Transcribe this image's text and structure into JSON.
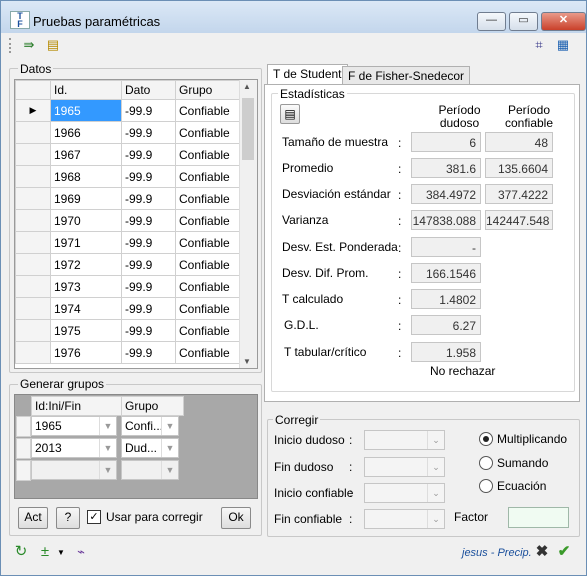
{
  "window": {
    "title": "Pruebas paramétricas",
    "minimize": "—",
    "maximize": "▭",
    "close": "✕"
  },
  "datos": {
    "label": "Datos",
    "headers": [
      "Id.",
      "Dato",
      "Grupo"
    ],
    "rows": [
      [
        "1965",
        "-99.9",
        "Confiable"
      ],
      [
        "1966",
        "-99.9",
        "Confiable"
      ],
      [
        "1967",
        "-99.9",
        "Confiable"
      ],
      [
        "1968",
        "-99.9",
        "Confiable"
      ],
      [
        "1969",
        "-99.9",
        "Confiable"
      ],
      [
        "1970",
        "-99.9",
        "Confiable"
      ],
      [
        "1971",
        "-99.9",
        "Confiable"
      ],
      [
        "1972",
        "-99.9",
        "Confiable"
      ],
      [
        "1973",
        "-99.9",
        "Confiable"
      ],
      [
        "1974",
        "-99.9",
        "Confiable"
      ],
      [
        "1975",
        "-99.9",
        "Confiable"
      ],
      [
        "1976",
        "-99.9",
        "Confiable"
      ]
    ]
  },
  "generar": {
    "label": "Generar grupos",
    "headers": [
      "Id:Ini/Fin",
      "Grupo"
    ],
    "rows": [
      [
        "1965",
        "Confi..."
      ],
      [
        "2013",
        "Dud..."
      ],
      [
        "",
        ""
      ]
    ],
    "act": "Act",
    "help": "?",
    "usar_label": "Usar para corregir",
    "ok": "Ok"
  },
  "tabs": [
    "T de Student",
    "F de Fisher-Snedecor"
  ],
  "estadisticas": {
    "label": "Estadísticas",
    "col1": "Período dudoso",
    "col2": "Período confiable",
    "rows": [
      {
        "label": "Tamaño de muestra",
        "v1": "6",
        "v2": "48"
      },
      {
        "label": "Promedio",
        "v1": "381.6",
        "v2": "135.6604"
      },
      {
        "label": "Desviación estándar",
        "v1": "384.4972",
        "v2": "377.4222"
      },
      {
        "label": "Varianza",
        "v1": "147838.088",
        "v2": "142447.548"
      },
      {
        "label": "Desv. Est. Ponderada",
        "v1": "-"
      },
      {
        "label": "Desv. Dif. Prom.",
        "v1": "166.1546"
      },
      {
        "label": "T calculado",
        "v1": "1.4802"
      },
      {
        "label": "G.D.L.",
        "v1": "6.27"
      },
      {
        "label": "T tabular/crítico",
        "v1": "1.958"
      }
    ],
    "result": "No rechazar"
  },
  "corregir": {
    "label": "Corregir",
    "fields": [
      "Inicio dudoso",
      "Fin dudoso",
      "Inicio confiable",
      "Fin confiable"
    ],
    "options": [
      "Multiplicando",
      "Sumando",
      "Ecuación"
    ],
    "selected_option": "Multiplicando",
    "factor_label": "Factor"
  },
  "status": {
    "user": "jesus - Precip."
  },
  "colors": {
    "selection": "#3399ff",
    "accent": "#1a4f9c"
  }
}
